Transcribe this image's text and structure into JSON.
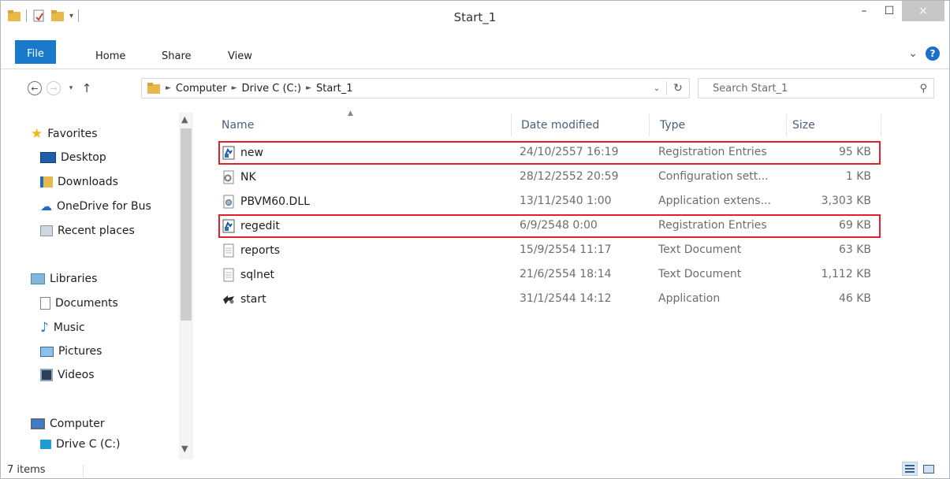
{
  "window": {
    "title": "Start_1"
  },
  "window_controls": {
    "minimize": "–",
    "maximize": "☐",
    "close": "×"
  },
  "ribbon": {
    "tabs": [
      "File",
      "Home",
      "Share",
      "View"
    ],
    "expand_glyph": "⌄",
    "help_glyph": "?"
  },
  "address": {
    "breadcrumbs": [
      "Computer",
      "Drive C (C:)",
      "Start_1"
    ],
    "search_placeholder": "Search Start_1"
  },
  "nav_pane": {
    "favorites": {
      "label": "Favorites",
      "items": [
        "Desktop",
        "Downloads",
        "OneDrive for Bus",
        "Recent places"
      ]
    },
    "libraries": {
      "label": "Libraries",
      "items": [
        "Documents",
        "Music",
        "Pictures",
        "Videos"
      ]
    },
    "computer": {
      "label": "Computer",
      "items": [
        "Drive C (C:)"
      ]
    }
  },
  "file_list": {
    "columns": {
      "name": "Name",
      "date": "Date modified",
      "type": "Type",
      "size": "Size"
    },
    "rows": [
      {
        "name": "new",
        "date": "24/10/2557 16:19",
        "type": "Registration Entries",
        "size": "95 KB",
        "icon": "registry-file-icon",
        "highlighted": true
      },
      {
        "name": "NK",
        "date": "28/12/2552 20:59",
        "type": "Configuration sett...",
        "size": "1 KB",
        "icon": "config-file-icon",
        "highlighted": false
      },
      {
        "name": "PBVM60.DLL",
        "date": "13/11/2540 1:00",
        "type": "Application extens...",
        "size": "3,303 KB",
        "icon": "dll-file-icon",
        "highlighted": false
      },
      {
        "name": "regedit",
        "date": "6/9/2548 0:00",
        "type": "Registration Entries",
        "size": "69 KB",
        "icon": "registry-file-icon",
        "highlighted": true
      },
      {
        "name": "reports",
        "date": "15/9/2554 11:17",
        "type": "Text Document",
        "size": "63 KB",
        "icon": "text-file-icon",
        "highlighted": false
      },
      {
        "name": "sqlnet",
        "date": "21/6/2554 18:14",
        "type": "Text Document",
        "size": "1,112 KB",
        "icon": "text-file-icon",
        "highlighted": false
      },
      {
        "name": "start",
        "date": "31/1/2544 14:12",
        "type": "Application",
        "size": "46 KB",
        "icon": "application-icon",
        "highlighted": false
      }
    ]
  },
  "status_bar": {
    "item_count": "7 items"
  },
  "colors": {
    "accent": "#1979ca",
    "highlight_border": "#e4202b",
    "folder": "#e8b84a"
  }
}
